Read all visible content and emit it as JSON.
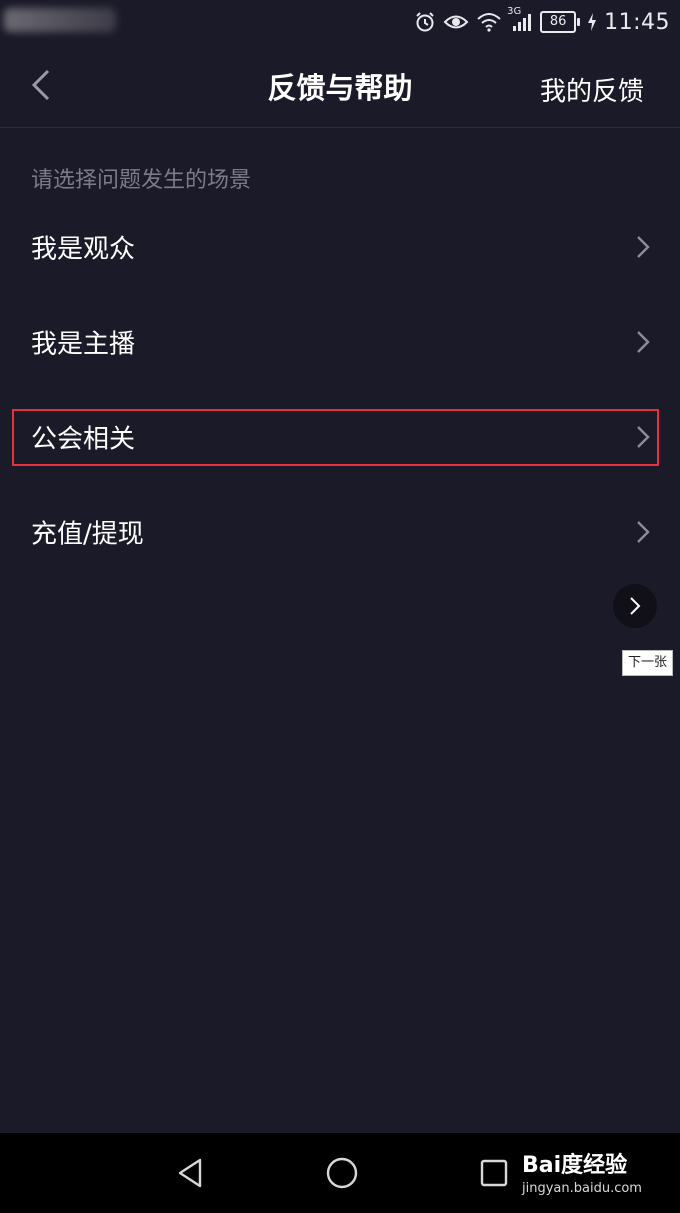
{
  "status_bar": {
    "battery_level": "86",
    "network": "3G",
    "time": "11:45",
    "icons": [
      "alarm-icon",
      "eye-icon",
      "wifi-icon",
      "signal-icon",
      "battery-icon",
      "charging-icon"
    ]
  },
  "header": {
    "back_icon": "chevron-left-icon",
    "title": "反馈与帮助",
    "my_feedback": "我的反馈"
  },
  "hint": "请选择问题发生的场景",
  "scenes": [
    {
      "label": "我是观众"
    },
    {
      "label": "我是主播"
    },
    {
      "label": "公会相关",
      "highlighted": true
    },
    {
      "label": "充值/提现"
    }
  ],
  "overlay": {
    "next_icon": "chevron-right-icon",
    "next_tooltip": "下一张"
  },
  "system_nav": {
    "icons": [
      "back-triangle-icon",
      "home-circle-icon",
      "recents-square-icon"
    ]
  },
  "watermark": {
    "logo_text": "Bai度经验",
    "url": "jingyan.baidu.com"
  },
  "colors": {
    "background": "#1b1a28",
    "highlight_border": "#e5323e",
    "hint_text": "#7c7b89"
  }
}
